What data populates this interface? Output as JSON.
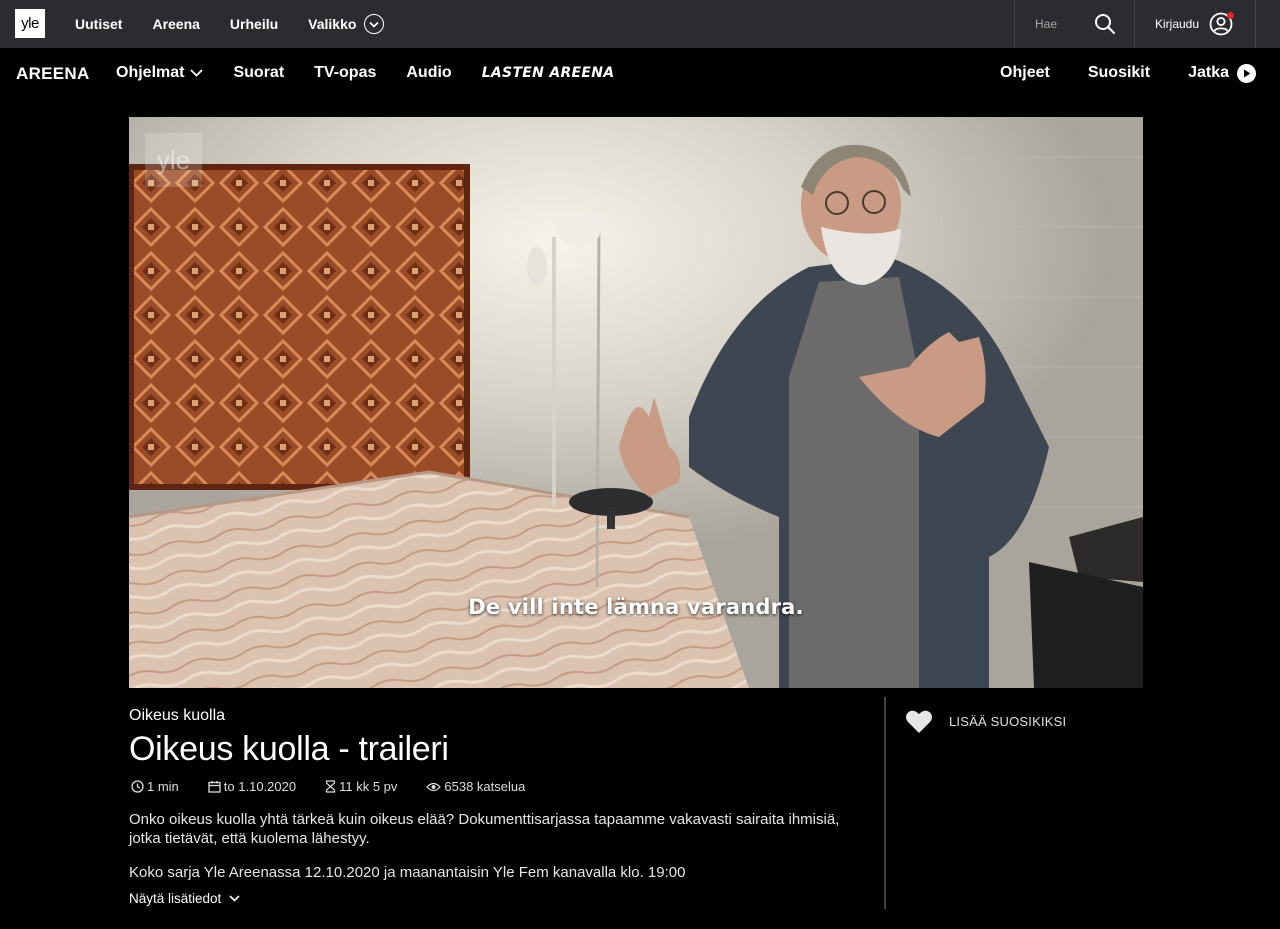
{
  "topbar": {
    "logo": "yle",
    "nav": [
      "Uutiset",
      "Areena",
      "Urheilu"
    ],
    "menu_label": "Valikko",
    "search_placeholder": "Hae",
    "login_label": "Kirjaudu"
  },
  "areena_nav": {
    "logo": "AREENA",
    "items": [
      "Ohjelmat",
      "Suorat",
      "TV-opas",
      "Audio",
      "LASTEN AREENA"
    ],
    "right_items": [
      "Ohjeet",
      "Suosikit",
      "Jatka"
    ]
  },
  "video": {
    "watermark": "yle",
    "subtitle": "De vill inte lämna varandra."
  },
  "program": {
    "series_title": "Oikeus kuolla",
    "title": "Oikeus kuolla - traileri",
    "duration": "1 min",
    "date": "to 1.10.2020",
    "availability": "11 kk 5 pv",
    "views": "6538 katselua",
    "description": "Onko oikeus kuolla yhtä tärkeä kuin oikeus elää? Dokumenttisarjassa tapaamme vakavasti sairaita ihmisiä, jotka tietävät, että kuolema lähestyy.",
    "description2": "Koko sarja Yle Areenassa 12.10.2020 ja maanantaisin Yle Fem kanavalla klo. 19:00",
    "show_more": "Näytä lisätiedot",
    "add_favorite": "LISÄÄ SUOSIKIKSI"
  }
}
